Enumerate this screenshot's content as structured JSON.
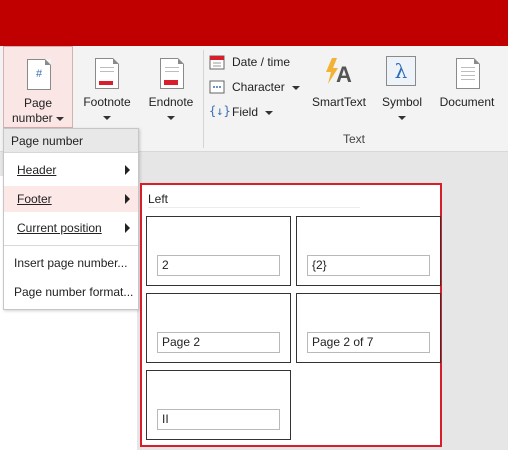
{
  "ribbon": {
    "page_number": {
      "line1": "Page",
      "line2": "number"
    },
    "footnote": "Footnote",
    "endnote": "Endnote",
    "date_time": "Date / time",
    "character": "Character",
    "field": "Field",
    "smarttext": "SmartText",
    "symbol": "Symbol",
    "document": "Document",
    "group_text": "Text"
  },
  "menu": {
    "title": "Page number",
    "items": [
      {
        "label": "Header",
        "has_submenu": true
      },
      {
        "label": "Footer",
        "has_submenu": true,
        "selected": true
      },
      {
        "label": "Current position",
        "has_submenu": true
      },
      {
        "label": "Insert page number...",
        "has_submenu": false
      },
      {
        "label": "Page number format...",
        "has_submenu": false
      }
    ]
  },
  "panel": {
    "heading": "Left",
    "options": [
      "2",
      "{2}",
      "Page 2",
      "Page 2 of 7",
      "II"
    ]
  },
  "colors": {
    "title_bar": "#c00000",
    "highlight_border": "#d81e2b",
    "menu_selection": "#fde8e8"
  }
}
